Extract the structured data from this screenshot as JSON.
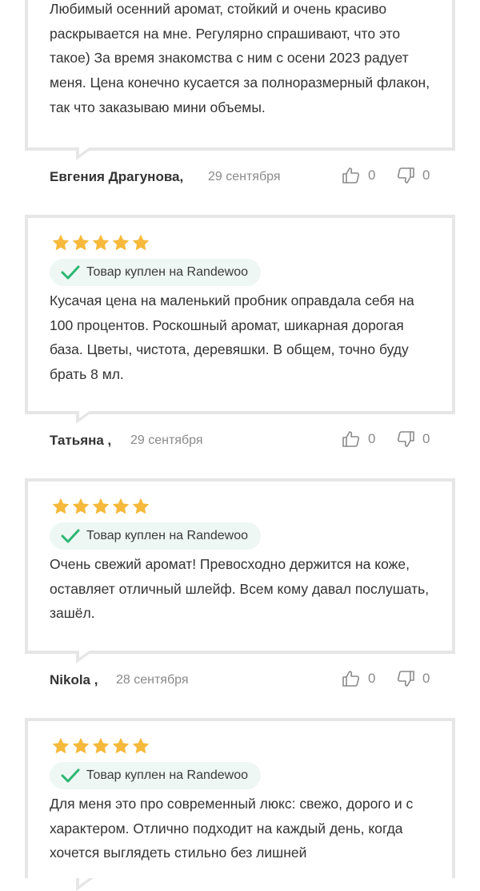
{
  "colors": {
    "star": "#f6b93b",
    "check": "#2bb673",
    "badge_bg": "#eef7f3",
    "border": "#e6e6e6"
  },
  "reviews": [
    {
      "text": "Любимый осенний аромат, стойкий и очень красиво раскрывается на мне. Регулярно спрашивают, что это такое) За время знакомства с ним с осени 2023 радует меня. Цена конечно кусается за полноразмерный флакон, так что заказываю мини объемы.",
      "author": "Евгения Драгунова,",
      "date": "29 сентября",
      "likes": "0",
      "dislikes": "0"
    },
    {
      "rating": 5,
      "badge": "Товар куплен на Randewoo",
      "text": "Кусачая цена на маленький пробник оправдала себя на 100 процентов. Роскошный аромат, шикарная дорогая база. Цветы, чистота, деревяшки. В общем, точно буду брать 8 мл.",
      "author": "Татьяна ,",
      "date": "29 сентября",
      "likes": "0",
      "dislikes": "0"
    },
    {
      "rating": 5,
      "badge": "Товар куплен на Randewoo",
      "text": "Очень свежий аромат! Превосходно держится на коже, оставляет отличный шлейф. Всем кому давал послушать, зашёл.",
      "author": "Nikola ,",
      "date": "28 сентября",
      "likes": "0",
      "dislikes": "0"
    },
    {
      "rating": 5,
      "badge": "Товар куплен на Randewoo",
      "text": "Для меня это про современный люкс: свежо, дорого и с характером. Отлично подходит на каждый день, когда хочется выглядеть стильно без лишней"
    }
  ]
}
